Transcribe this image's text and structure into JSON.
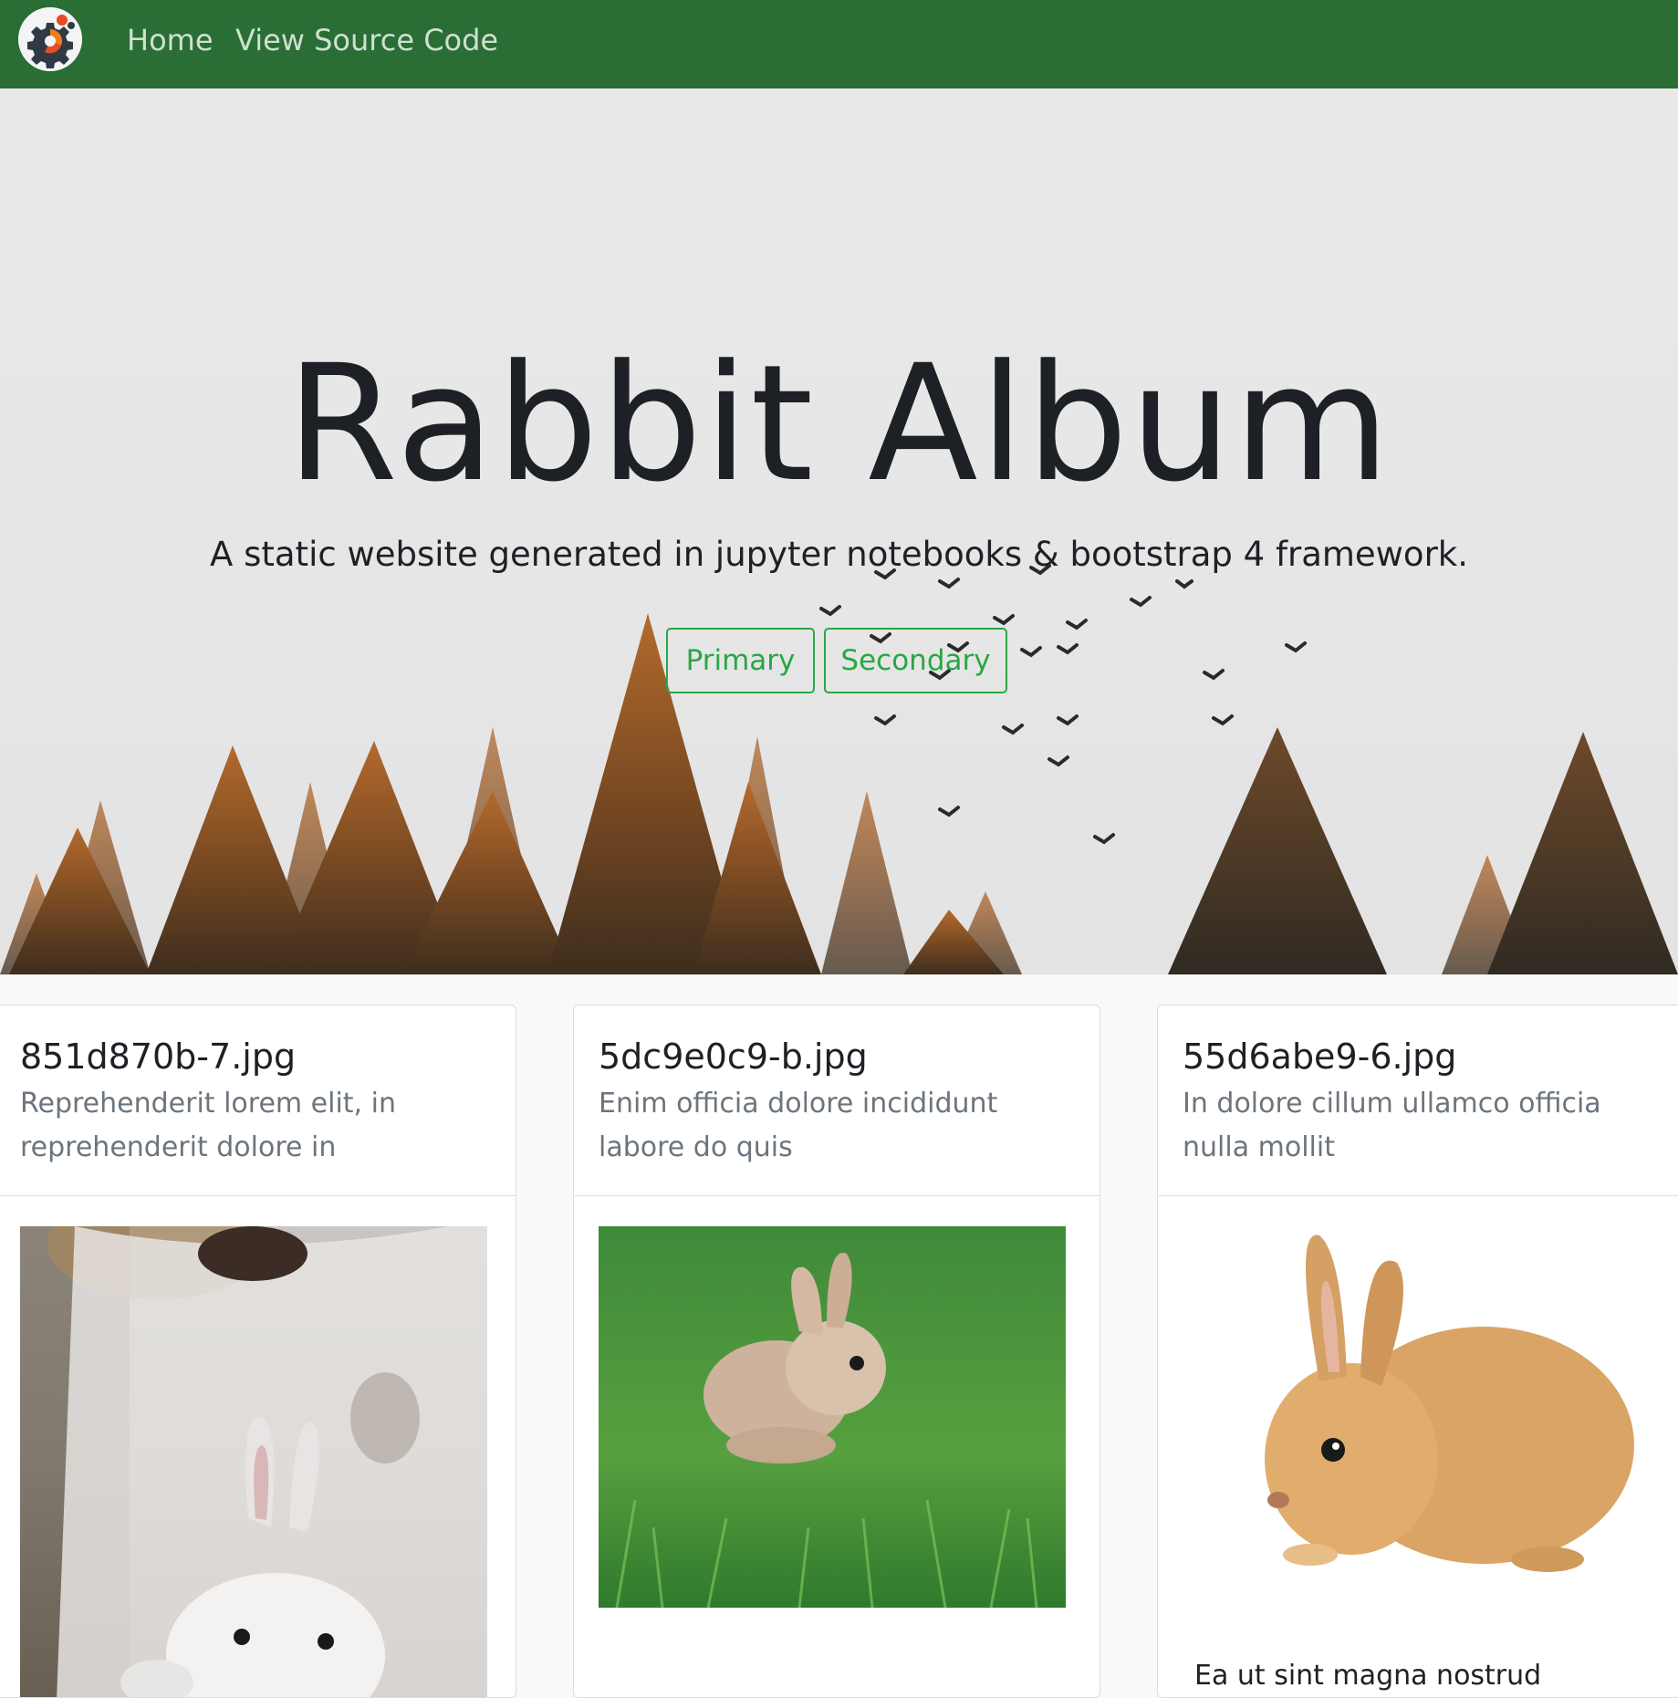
{
  "navbar": {
    "logo": "gear-logo-icon",
    "links": [
      {
        "label": "Home"
      },
      {
        "label": "View Source Code"
      }
    ],
    "color": "#2a6d35"
  },
  "hero": {
    "title": "Rabbit Album",
    "subtitle": "A static website generated in jupyter notebooks & bootstrap 4 framework.",
    "buttons": [
      {
        "label": "Primary"
      },
      {
        "label": "Secondary"
      }
    ],
    "button_color": "#28a745"
  },
  "cards": [
    {
      "title": "851d870b-7.jpg",
      "text": "Reprehenderit lorem elit, in reprehenderit dolore in",
      "image": "white-rabbit-held-by-child"
    },
    {
      "title": "5dc9e0c9-b.jpg",
      "text": "Enim officia dolore incididunt labore do quis",
      "image": "fluffy-rabbit-on-grass"
    },
    {
      "title": "55d6abe9-6.jpg",
      "text": "In dolore cillum ullamco officia nulla mollit",
      "image": "orange-rabbit-on-white",
      "footer_text": "Ea ut sint magna nostrud"
    }
  ]
}
